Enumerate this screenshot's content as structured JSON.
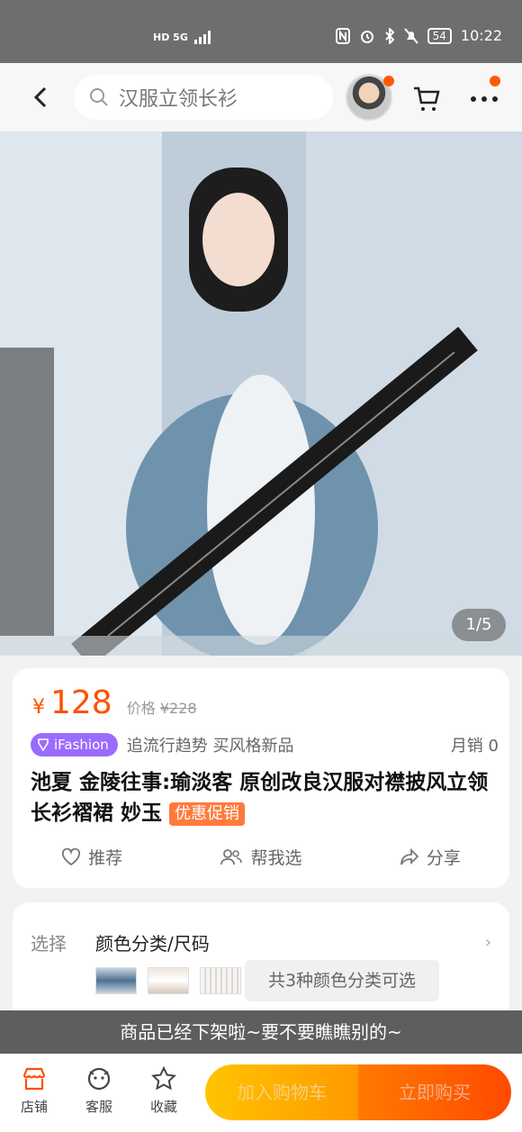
{
  "status_bar": {
    "network": "HD 5G",
    "battery": "54",
    "time": "10:22"
  },
  "header": {
    "search_text": "汉服立领长衫"
  },
  "gallery": {
    "counter": "1/5"
  },
  "product": {
    "currency": "¥",
    "price": "128",
    "orig_label": "价格",
    "orig_price": "¥228",
    "brand_tag": "iFashion",
    "slogan": "追流行趋势 买风格新品",
    "monthly_sales": "月销  0",
    "title": "池夏 金陵往事:瑜淡客 原创改良汉服对襟披风立领长衫褶裙 妙玉",
    "promo_tag": "优惠促销",
    "actions": {
      "recommend": "推荐",
      "help_choose": "帮我选",
      "share": "分享"
    }
  },
  "selection": {
    "label": "选择",
    "value": "颜色分类/尺码",
    "options_note": "共3种颜色分类可选"
  },
  "toast": "商品已经下架啦~要不要瞧瞧别的~",
  "bottom_bar": {
    "shop": "店铺",
    "service": "客服",
    "favorite": "收藏",
    "add_to_cart": "加入购物车",
    "buy_now": "立即购买"
  },
  "colors": {
    "accent": "#ff5000",
    "brand_purple": "#9a6bff",
    "cart_yellow": "#ffc400",
    "buy_orange": "#ff4a00"
  }
}
